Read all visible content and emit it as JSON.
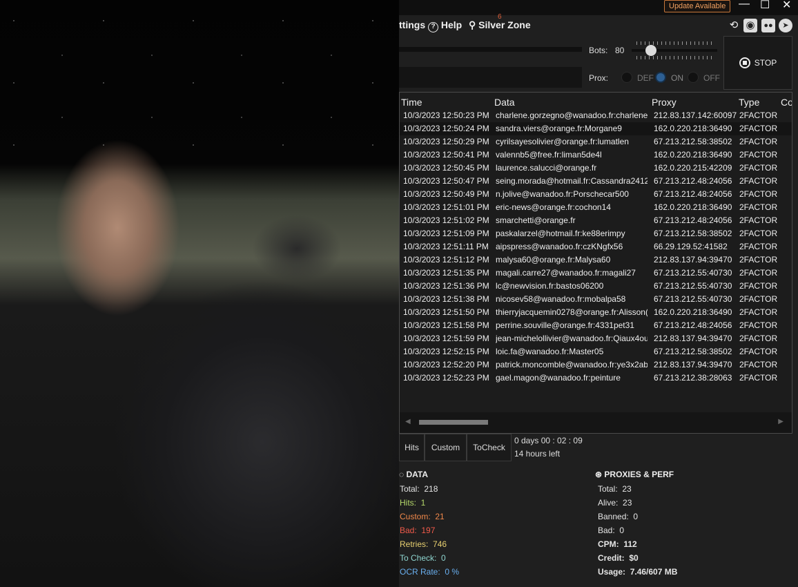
{
  "titlebar": {
    "update_label": "Update Available",
    "minimize": "—",
    "maximize": "☐",
    "close": "✕"
  },
  "menu": {
    "settings": "ttings",
    "help": "Help",
    "zone": "Silver Zone",
    "zone_badge": "6"
  },
  "toolbar_icons": [
    "history-icon",
    "camera-icon",
    "discord-icon",
    "telegram-icon"
  ],
  "controls": {
    "bots_label": "Bots:",
    "bots_value": "80",
    "bots_fraction": 0.16,
    "prox_label": "Prox:",
    "prox_options": [
      "DEF",
      "ON",
      "OFF"
    ],
    "prox_selected": "ON",
    "stop_label": "STOP"
  },
  "table": {
    "columns": [
      "Time",
      "Data",
      "Proxy",
      "Type",
      "Co"
    ],
    "rows": [
      [
        "10/3/2023 12:50:23 PM",
        "charlene.gorzegno@wanadoo.fr:charlene",
        "212.83.137.142:60097",
        "2FACTOR"
      ],
      [
        "10/3/2023 12:50:24 PM",
        "sandra.viers@orange.fr:Morgane9",
        "162.0.220.218:36490",
        "2FACTOR"
      ],
      [
        "10/3/2023 12:50:29 PM",
        "cyrilsayesolivier@orange.fr:lumatlen",
        "67.213.212.58:38502",
        "2FACTOR"
      ],
      [
        "10/3/2023 12:50:41 PM",
        "valennb5@free.fr:liman5de4l",
        "162.0.220.218:36490",
        "2FACTOR"
      ],
      [
        "10/3/2023 12:50:45 PM",
        "laurence.salucci@orange.fr",
        "162.0.220.215:42209",
        "2FACTOR"
      ],
      [
        "10/3/2023 12:50:47 PM",
        "seing.morada@hotmail.fr:Cassandra2412",
        "67.213.212.48:24056",
        "2FACTOR"
      ],
      [
        "10/3/2023 12:50:49 PM",
        "n.jolive@wanadoo.fr:Porschecar500",
        "67.213.212.48:24056",
        "2FACTOR"
      ],
      [
        "10/3/2023 12:51:01 PM",
        "eric-news@orange.fr:cochon14",
        "162.0.220.218:36490",
        "2FACTOR"
      ],
      [
        "10/3/2023 12:51:02 PM",
        "smarchetti@orange.fr",
        "67.213.212.48:24056",
        "2FACTOR"
      ],
      [
        "10/3/2023 12:51:09 PM",
        "paskalarzel@hotmail.fr:ke88erimpy",
        "67.213.212.58:38502",
        "2FACTOR"
      ],
      [
        "10/3/2023 12:51:11 PM",
        "aipspress@wanadoo.fr:czKNgfx56",
        "66.29.129.52:41582",
        "2FACTOR"
      ],
      [
        "10/3/2023 12:51:12 PM",
        "malysa60@orange.fr:Malysa60",
        "212.83.137.94:39470",
        "2FACTOR"
      ],
      [
        "10/3/2023 12:51:35 PM",
        "magali.carre27@wanadoo.fr:magali27",
        "67.213.212.55:40730",
        "2FACTOR"
      ],
      [
        "10/3/2023 12:51:36 PM",
        "lc@newvision.fr:bastos06200",
        "67.213.212.55:40730",
        "2FACTOR"
      ],
      [
        "10/3/2023 12:51:38 PM",
        "nicosev58@wanadoo.fr:mobalpa58",
        "67.213.212.55:40730",
        "2FACTOR"
      ],
      [
        "10/3/2023 12:51:50 PM",
        "thierryjacquemin0278@orange.fr:Alisson(",
        "162.0.220.218:36490",
        "2FACTOR"
      ],
      [
        "10/3/2023 12:51:58 PM",
        "perrine.souville@orange.fr:4331pet31",
        "67.213.212.48:24056",
        "2FACTOR"
      ],
      [
        "10/3/2023 12:51:59 PM",
        "jean-michelollivier@wanadoo.fr:Qiaux4ou",
        "212.83.137.94:39470",
        "2FACTOR"
      ],
      [
        "10/3/2023 12:52:15 PM",
        "loic.fa@wanadoo.fr:Master05",
        "67.213.212.58:38502",
        "2FACTOR"
      ],
      [
        "10/3/2023 12:52:20 PM",
        "patrick.moncomble@wanadoo.fr:ye3x2ab",
        "212.83.137.94:39470",
        "2FACTOR"
      ],
      [
        "10/3/2023 12:52:23 PM",
        "gael.magon@wanadoo.fr:peinture",
        "67.213.212.38:28063",
        "2FACTOR"
      ]
    ]
  },
  "tabs": [
    "Hits",
    "Custom",
    "ToCheck"
  ],
  "timer": {
    "elapsed": "0  days  00 : 02 : 09",
    "remaining": "14 hours left"
  },
  "data_stats": {
    "title": "DATA",
    "items": [
      {
        "label": "Total:",
        "value": "218",
        "color": "#e6e6e6"
      },
      {
        "label": "Hits:",
        "value": "1",
        "color": "#b5d86a"
      },
      {
        "label": "Custom:",
        "value": "21",
        "color": "#f0884a"
      },
      {
        "label": "Bad:",
        "value": "197",
        "color": "#f05a4a"
      },
      {
        "label": "Retries:",
        "value": "746",
        "color": "#e8d070"
      },
      {
        "label": "To Check:",
        "value": "0",
        "color": "#8fd6d0"
      },
      {
        "label": "OCR Rate:",
        "value": "0 %",
        "color": "#6ab0f0"
      }
    ]
  },
  "proxy_stats": {
    "title": "PROXIES & PERF",
    "items": [
      {
        "label": "Total:",
        "value": "23",
        "bold": false
      },
      {
        "label": "Alive:",
        "value": "23",
        "bold": false
      },
      {
        "label": "Banned:",
        "value": "0",
        "bold": false
      },
      {
        "label": "Bad:",
        "value": "0",
        "bold": false
      },
      {
        "label": "CPM:",
        "value": "112",
        "bold": true
      },
      {
        "label": "Credit:",
        "value": "$0",
        "bold": true
      },
      {
        "label": "Usage:",
        "value": "7.46/607 MB",
        "bold": true
      }
    ]
  }
}
